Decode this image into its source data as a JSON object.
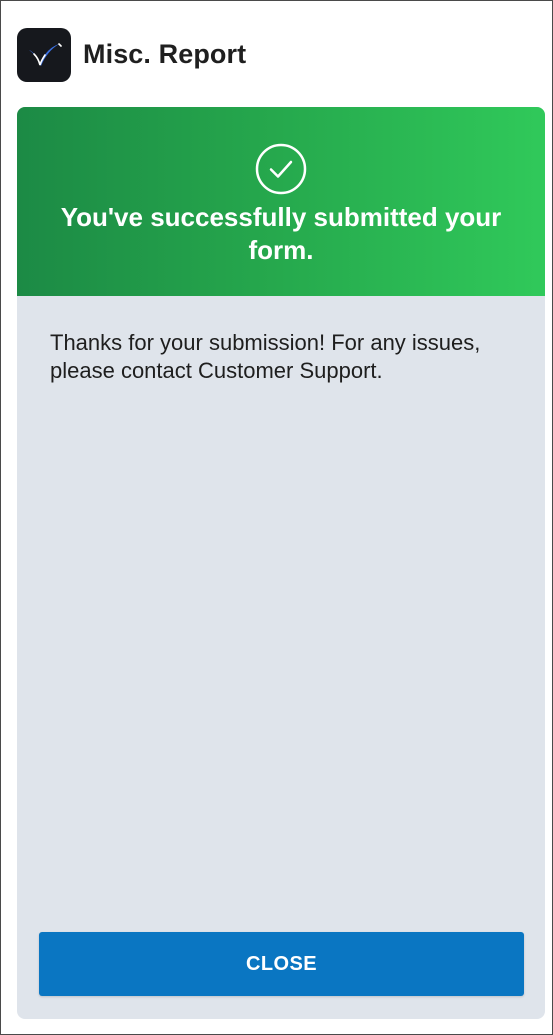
{
  "app": {
    "title": "Misc. Report",
    "logo_icon": "checkmark-swoosh-logo",
    "logo_background": "#16181d",
    "logo_accent": "#3b6fe0"
  },
  "banner": {
    "icon": "check-circle-icon",
    "message": "You've successfully submitted your form.",
    "gradient_start": "#1c8a45",
    "gradient_end": "#30c95a"
  },
  "content": {
    "message": "Thanks for your submission! For any issues, please contact Customer Support."
  },
  "actions": {
    "close_label": "CLOSE",
    "close_color": "#0a76c2"
  }
}
